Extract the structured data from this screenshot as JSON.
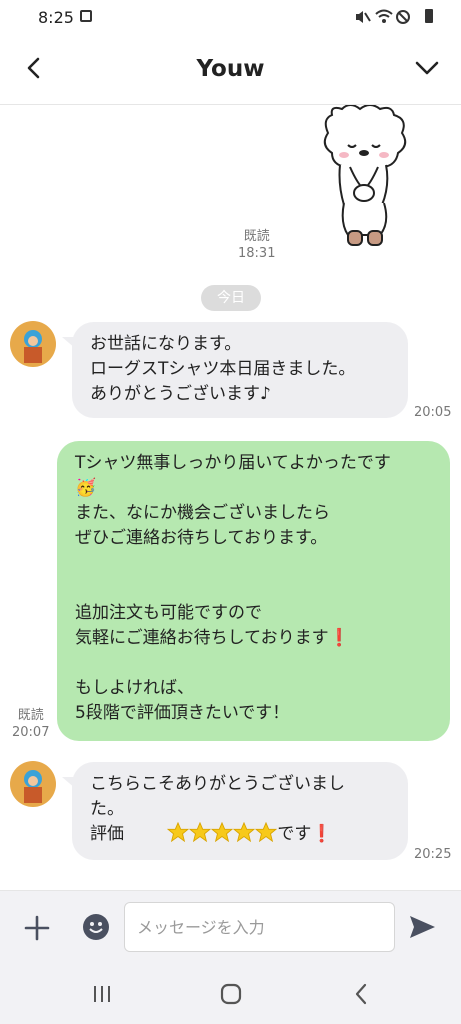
{
  "status_bar": {
    "time": "8:25"
  },
  "header": {
    "title": "Youw"
  },
  "messages": {
    "read_label": "既読",
    "sticker_time": "18:31",
    "date_divider": "今日",
    "m1": {
      "lines": [
        "お世話になります。",
        "ローグスTシャツ本日届きました。",
        "ありがとうございます♪"
      ],
      "time": "20:05"
    },
    "m2": {
      "lines": [
        "Tシャツ無事しっかり届いてよかったです",
        "🥳",
        "また、なにか機会ございましたら",
        "ぜひご連絡お待ちしております。",
        "",
        "",
        "追加注文も可能ですので",
        "気軽にご連絡お待ちしております❗",
        "",
        "もしよければ、",
        "5段階で評価頂きたいです！"
      ],
      "read": "既読",
      "time": "20:07"
    },
    "m3": {
      "lines": [
        "こちらこそありがとうございまし",
        "た。"
      ],
      "rating_label": "評価",
      "rating_suffix": "です❗",
      "stars": "⭐⭐⭐⭐⭐",
      "rating_value": 5,
      "time": "20:25"
    }
  },
  "composer": {
    "placeholder": "メッセージを入力"
  }
}
